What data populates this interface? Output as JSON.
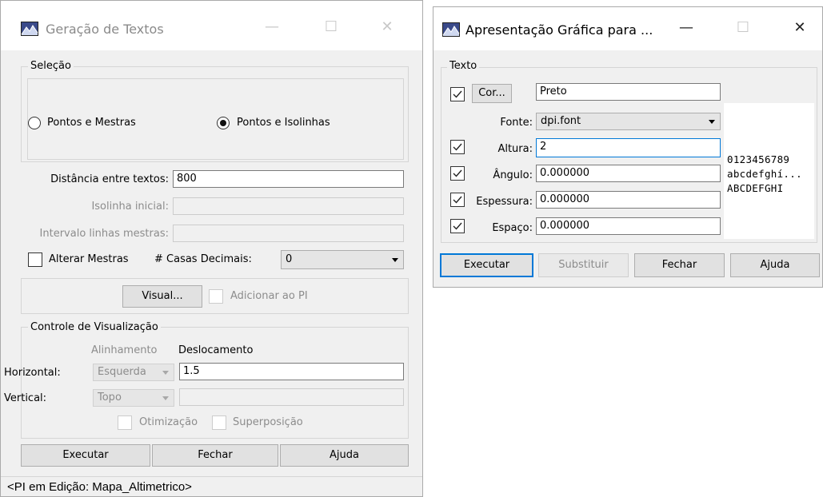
{
  "win1": {
    "title": "Geração de Textos",
    "titlebar_buttons": {
      "minimize": "—",
      "maximize": "☐",
      "close": "✕"
    },
    "selecao": {
      "title": "Seleção",
      "radio_1": "Pontos e Mestras",
      "radio_2": "Pontos e Isolinhas",
      "selected": "Pontos e Isolinhas"
    },
    "fields": {
      "distancia_label": "Distância entre textos:",
      "distancia_value": "800",
      "isolinha_label": "Isolinha inicial:",
      "isolinha_value": "",
      "intervalo_label": "Intervalo linhas mestras:",
      "intervalo_value": "",
      "alterar_label": "Alterar Mestras",
      "alterar_checked": false,
      "casas_label": "# Casas Decimais:",
      "casas_value": "0"
    },
    "visual": {
      "visual_button": "Visual...",
      "adicionar_label": "Adicionar ao PI",
      "adicionar_checked": false
    },
    "controle": {
      "title": "Controle de Visualização",
      "alinhamento_header": "Alinhamento",
      "deslocamento_header": "Deslocamento",
      "horizontal_label": "Horizontal:",
      "horizontal_align": "Esquerda",
      "horizontal_offset": "1.5",
      "vertical_label": "Vertical:",
      "vertical_align": "Topo",
      "vertical_offset": "",
      "otimizacao_label": "Otimização",
      "superposicao_label": "Superposição"
    },
    "buttons": {
      "executar": "Executar",
      "fechar": "Fechar",
      "ajuda": "Ajuda"
    },
    "status": "<PI em Edição: Mapa_Altimetrico>"
  },
  "win2": {
    "title": "Apresentação Gráfica para ...",
    "titlebar_buttons": {
      "minimize": "—",
      "maximize": "☐",
      "close": "✕"
    },
    "texto": {
      "title": "Texto",
      "cor_button": "Cor...",
      "cor_checked": true,
      "cor_value": "Preto",
      "fonte_label": "Fonte:",
      "fonte_value": "dpi.font",
      "altura_label": "Altura:",
      "altura_checked": true,
      "altura_value": "2",
      "angulo_label": "Ângulo:",
      "angulo_checked": true,
      "angulo_value": "0.000000",
      "espessura_label": "Espessura:",
      "espessura_checked": true,
      "espessura_value": "0.000000",
      "espaco_label": "Espaço:",
      "espaco_checked": true,
      "espaco_value": "0.000000",
      "preview_lines": [
        "0123456789",
        "abcdefghí...",
        "ABCDEFGHI"
      ]
    },
    "buttons": {
      "executar": "Executar",
      "substituir": "Substituir",
      "fechar": "Fechar",
      "ajuda": "Ajuda"
    }
  },
  "colors": {
    "window_bg": "#f0f0f0",
    "titlebar_bg": "#ffffff",
    "accent": "#0078d7",
    "disabled_text": "#8c8c8c"
  }
}
